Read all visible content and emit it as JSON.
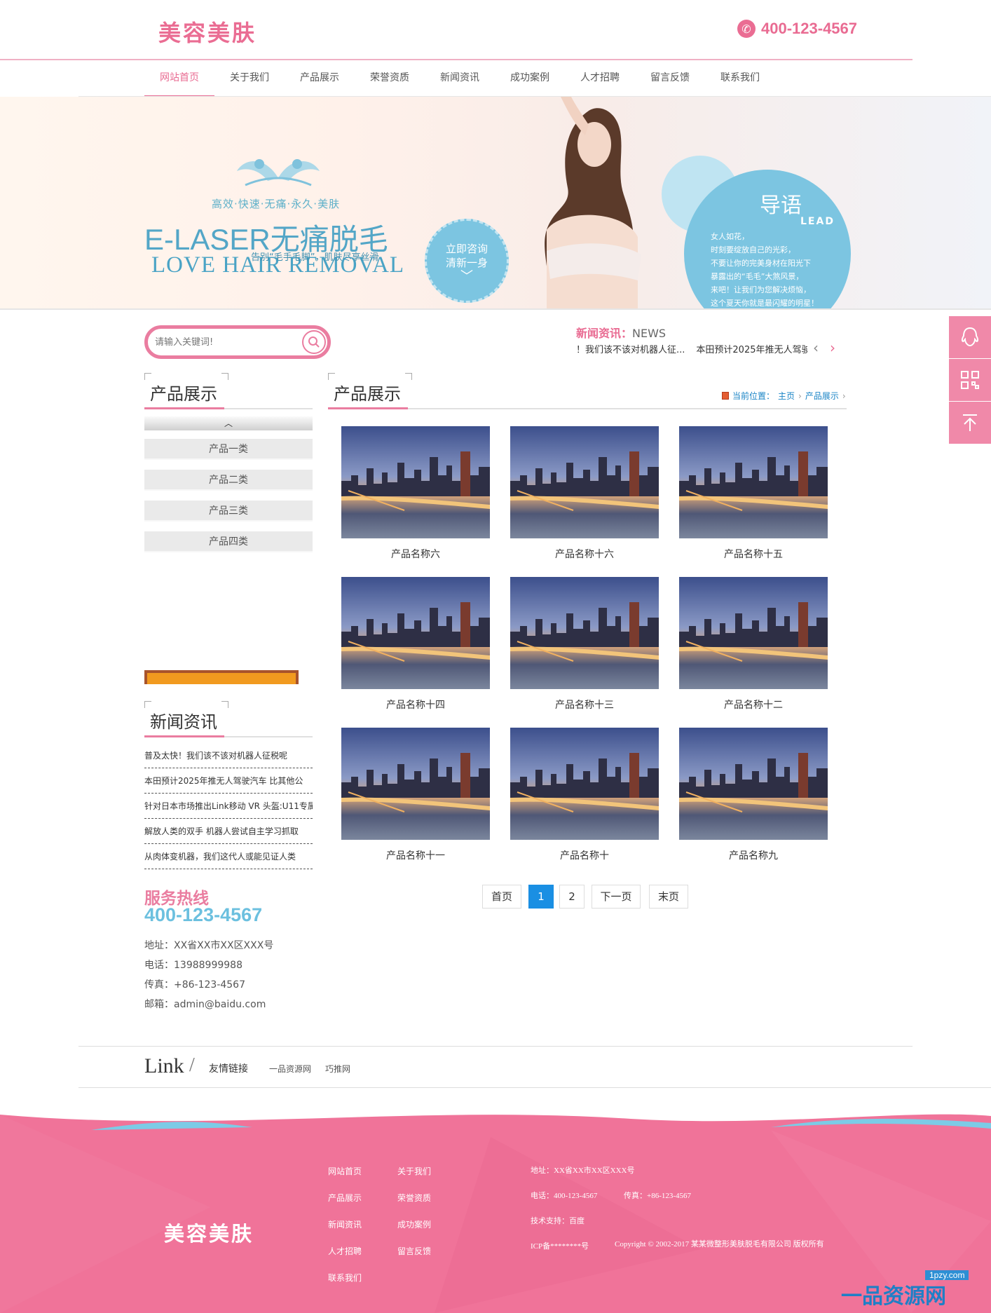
{
  "header": {
    "logo": "美容美肤",
    "phone": "400-123-4567"
  },
  "nav": [
    {
      "label": "网站首页",
      "active": true
    },
    {
      "label": "关于我们"
    },
    {
      "label": "产品展示"
    },
    {
      "label": "荣誉资质"
    },
    {
      "label": "新闻资讯"
    },
    {
      "label": "成功案例"
    },
    {
      "label": "人才招聘"
    },
    {
      "label": "留言反馈"
    },
    {
      "label": "联系我们"
    }
  ],
  "banner": {
    "subtitle": "高效·快速·无痛·永久·美肤",
    "title": "E-LASER无痛脱毛",
    "tagline": "告别“毛手毛脚”，肌肤尽享丝滑",
    "english": "LOVE HAIR REMOVAL",
    "consult": [
      "立即咨询",
      "清新一身"
    ],
    "lead_title": "导语",
    "lead_en": "LEAD",
    "lead_text": [
      "女人如花，",
      "时刻要绽放自己的光彩，",
      "不要让你的完美身材在阳光下",
      "暴露出的“毛毛”大煞风景，",
      "来吧！让我们为您解决烦恼，",
      "这个夏天你就是最闪耀的明星！"
    ]
  },
  "search": {
    "placeholder": "请输入关键词!"
  },
  "news_ticker": {
    "label_cn": "新闻资讯：",
    "label_en": "NEWS",
    "items": [
      "！我们该不该对机器人征...",
      "本田预计2025年推无人驾驶汽车"
    ]
  },
  "sidebar": {
    "products_title": "产品展示",
    "categories": [
      "产品一类",
      "产品二类",
      "产品三类",
      "产品四类"
    ],
    "news_title": "新闻资讯",
    "news": [
      "普及太快！我们该不该对机器人征税呢",
      "本田预计2025年推无人驾驶汽车 比其他公",
      "针对日本市场推出Link移动 VR 头盔:U11专属",
      "解放人类的双手 机器人尝试自主学习抓取",
      "从肉体变机器，我们这代人或能见证人类"
    ],
    "hotline_label": "服务热线",
    "hotline": "400-123-4567",
    "contact": [
      "地址：XX省XX市XX区XXX号",
      "电话：13988999988",
      "传真：+86-123-4567",
      "邮箱：admin@baidu.com"
    ]
  },
  "main": {
    "title": "产品展示",
    "breadcrumb": {
      "label": "当前位置：",
      "home": "主页",
      "current": "产品展示"
    },
    "products": [
      "产品名称六",
      "产品名称十六",
      "产品名称十五",
      "产品名称十四",
      "产品名称十三",
      "产品名称十二",
      "产品名称十一",
      "产品名称十",
      "产品名称九"
    ],
    "pagination": {
      "first": "首页",
      "pages": [
        "1",
        "2"
      ],
      "current": "1",
      "next": "下一页",
      "last": "末页"
    }
  },
  "links": {
    "word": "Link",
    "slash": "/",
    "title": "友情链接",
    "items": [
      "一品资源网",
      "巧推网"
    ]
  },
  "footer": {
    "logo": "美容美肤",
    "nav_col1": [
      "网站首页",
      "产品展示",
      "新闻资讯",
      "人才招聘",
      "联系我们"
    ],
    "nav_col2": [
      "关于我们",
      "荣誉资质",
      "成功案例",
      "留言反馈"
    ],
    "address": "地址：XX省XX市XX区XXX号",
    "phone": "电话：400-123-4567",
    "fax": "传真：+86-123-4567",
    "support": "技术支持：百度",
    "icp": "ICP备********号",
    "copyright": "Copyright © 2002-2017 某某微整形美肤脱毛有限公司 版权所有"
  },
  "watermark": {
    "big": "一品资源网",
    "small": "1pzy.com"
  },
  "colors": {
    "pink": "#ea6d93",
    "light_pink": "#f089a9",
    "blue": "#6cc0df",
    "footer_pink": "#f07399",
    "active_page": "#1a8fe3"
  }
}
